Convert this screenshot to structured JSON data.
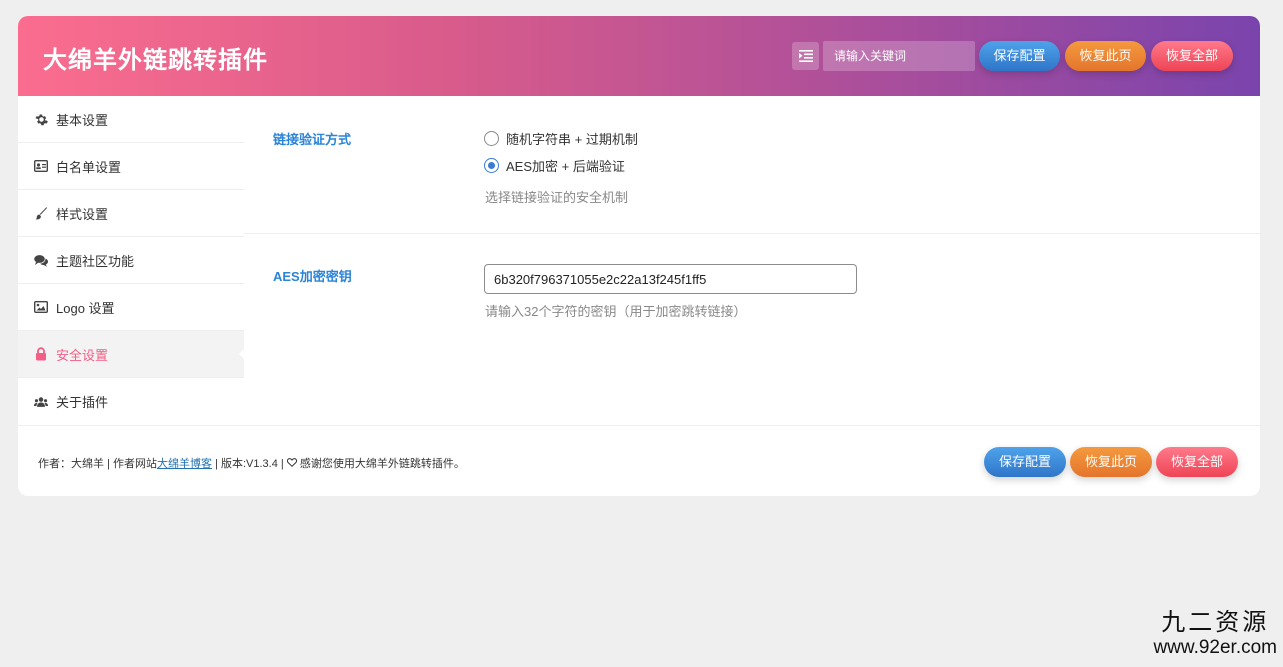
{
  "header": {
    "title": "大绵羊外链跳转插件",
    "search_placeholder": "请输入关键词",
    "save_label": "保存配置",
    "reset_page_label": "恢复此页",
    "reset_all_label": "恢复全部"
  },
  "sidebar": {
    "items": [
      {
        "label": "基本设置",
        "icon": "gear-icon"
      },
      {
        "label": "白名单设置",
        "icon": "id-card-icon"
      },
      {
        "label": "样式设置",
        "icon": "paintbrush-icon"
      },
      {
        "label": "主题社区功能",
        "icon": "comments-icon"
      },
      {
        "label": "Logo 设置",
        "icon": "image-icon"
      },
      {
        "label": "安全设置",
        "icon": "lock-icon",
        "active": true
      },
      {
        "label": "关于插件",
        "icon": "users-icon"
      }
    ]
  },
  "main": {
    "verify": {
      "label": "链接验证方式",
      "options": [
        "随机字符串 + 过期机制",
        "AES加密 + 后端验证"
      ],
      "selected_index": 1,
      "description": "选择链接验证的安全机制"
    },
    "aes_key": {
      "label": "AES加密密钥",
      "value": "6b320f796371055e2c22a13f245f1ff5",
      "description": "请输入32个字符的密钥（用于加密跳转链接）"
    }
  },
  "footer": {
    "author_prefix": "作者：大绵羊 | 作者网站",
    "site_link": "大绵羊博客",
    "version_text": " | 版本:V1.3.4 | ",
    "thanks": " 感谢您使用大绵羊外链跳转插件。",
    "save_label": "保存配置",
    "reset_page_label": "恢复此页",
    "reset_all_label": "恢复全部"
  },
  "watermark": {
    "cn": "九二资源",
    "url": "www.92er.com"
  },
  "colors": {
    "accent_pink": "#f35e86",
    "label_blue": "#2b84d8",
    "header_gradient_start": "#fb6d8f",
    "header_gradient_end": "#7a44ad"
  }
}
